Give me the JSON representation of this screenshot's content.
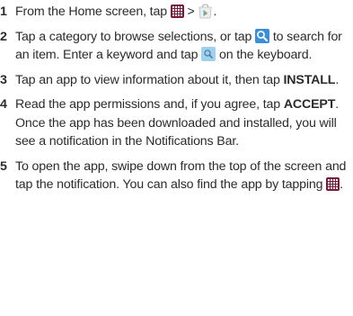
{
  "steps": [
    {
      "num": "1",
      "text_a": "From the Home screen, tap",
      "text_b": " > ",
      "text_c": "."
    },
    {
      "num": "2",
      "text_a": "Tap a category to browse selections, or tap",
      "text_b": " to search for an item. Enter a keyword and tap ",
      "text_c": " on the keyboard."
    },
    {
      "num": "3",
      "text_a": "Tap an app to view information about it, then tap ",
      "bold": "INSTALL",
      "text_b": "."
    },
    {
      "num": "4",
      "text_a": "Read the app permissions and, if you agree, tap ",
      "bold": "ACCEPT",
      "text_b": ". Once the app has been downloaded and installed, you will see a notification in the Notifications Bar."
    },
    {
      "num": "5",
      "text_a": "To open the app, swipe down from the top of the screen and tap the notification. You can also find the app by tapping ",
      "text_b": "."
    }
  ],
  "icons": {
    "apps": "apps-grid-icon",
    "play_store": "play-store-icon",
    "search": "search-icon",
    "keyboard_search": "keyboard-search-icon"
  },
  "colors": {
    "apps_icon": "#7a1a3a",
    "search_icon": "#3a8fd6",
    "keyboard_search_icon": "#9fd0ec",
    "text": "#2b2b2b"
  }
}
